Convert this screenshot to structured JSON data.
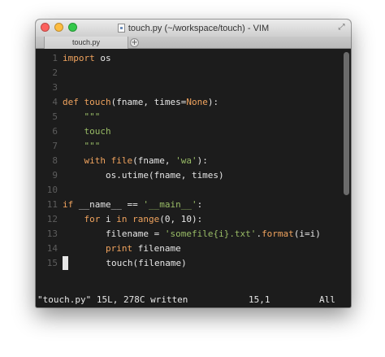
{
  "window": {
    "title": "touch.py (~/workspace/touch) - VIM",
    "tab_label": "touch.py",
    "new_tab_label": "+"
  },
  "editor": {
    "lines": [
      {
        "num": "1",
        "text": "import os"
      },
      {
        "num": "2",
        "text": ""
      },
      {
        "num": "3",
        "text": ""
      },
      {
        "num": "4",
        "text": "def touch(fname, times=None):"
      },
      {
        "num": "5",
        "text": "    \"\"\""
      },
      {
        "num": "6",
        "text": "    touch"
      },
      {
        "num": "7",
        "text": "    \"\"\""
      },
      {
        "num": "8",
        "text": "    with file(fname, 'wa'):"
      },
      {
        "num": "9",
        "text": "        os.utime(fname, times)"
      },
      {
        "num": "10",
        "text": ""
      },
      {
        "num": "11",
        "text": "if __name__ == '__main__':"
      },
      {
        "num": "12",
        "text": "    for i in range(0, 10):"
      },
      {
        "num": "13",
        "text": "        filename = 'somefile{i}.txt'.format(i=i)"
      },
      {
        "num": "14",
        "text": "        print filename"
      },
      {
        "num": "15",
        "text": "        touch(filename)"
      }
    ],
    "empty_line_marker": "~"
  },
  "status": {
    "message": "\"touch.py\" 15L, 278C written",
    "position": "15,1",
    "scroll": "All"
  },
  "colors": {
    "background": "#1c1c1c",
    "keyword": "#f0a35e",
    "string": "#99bc66",
    "line_number": "#5d5d5d"
  }
}
